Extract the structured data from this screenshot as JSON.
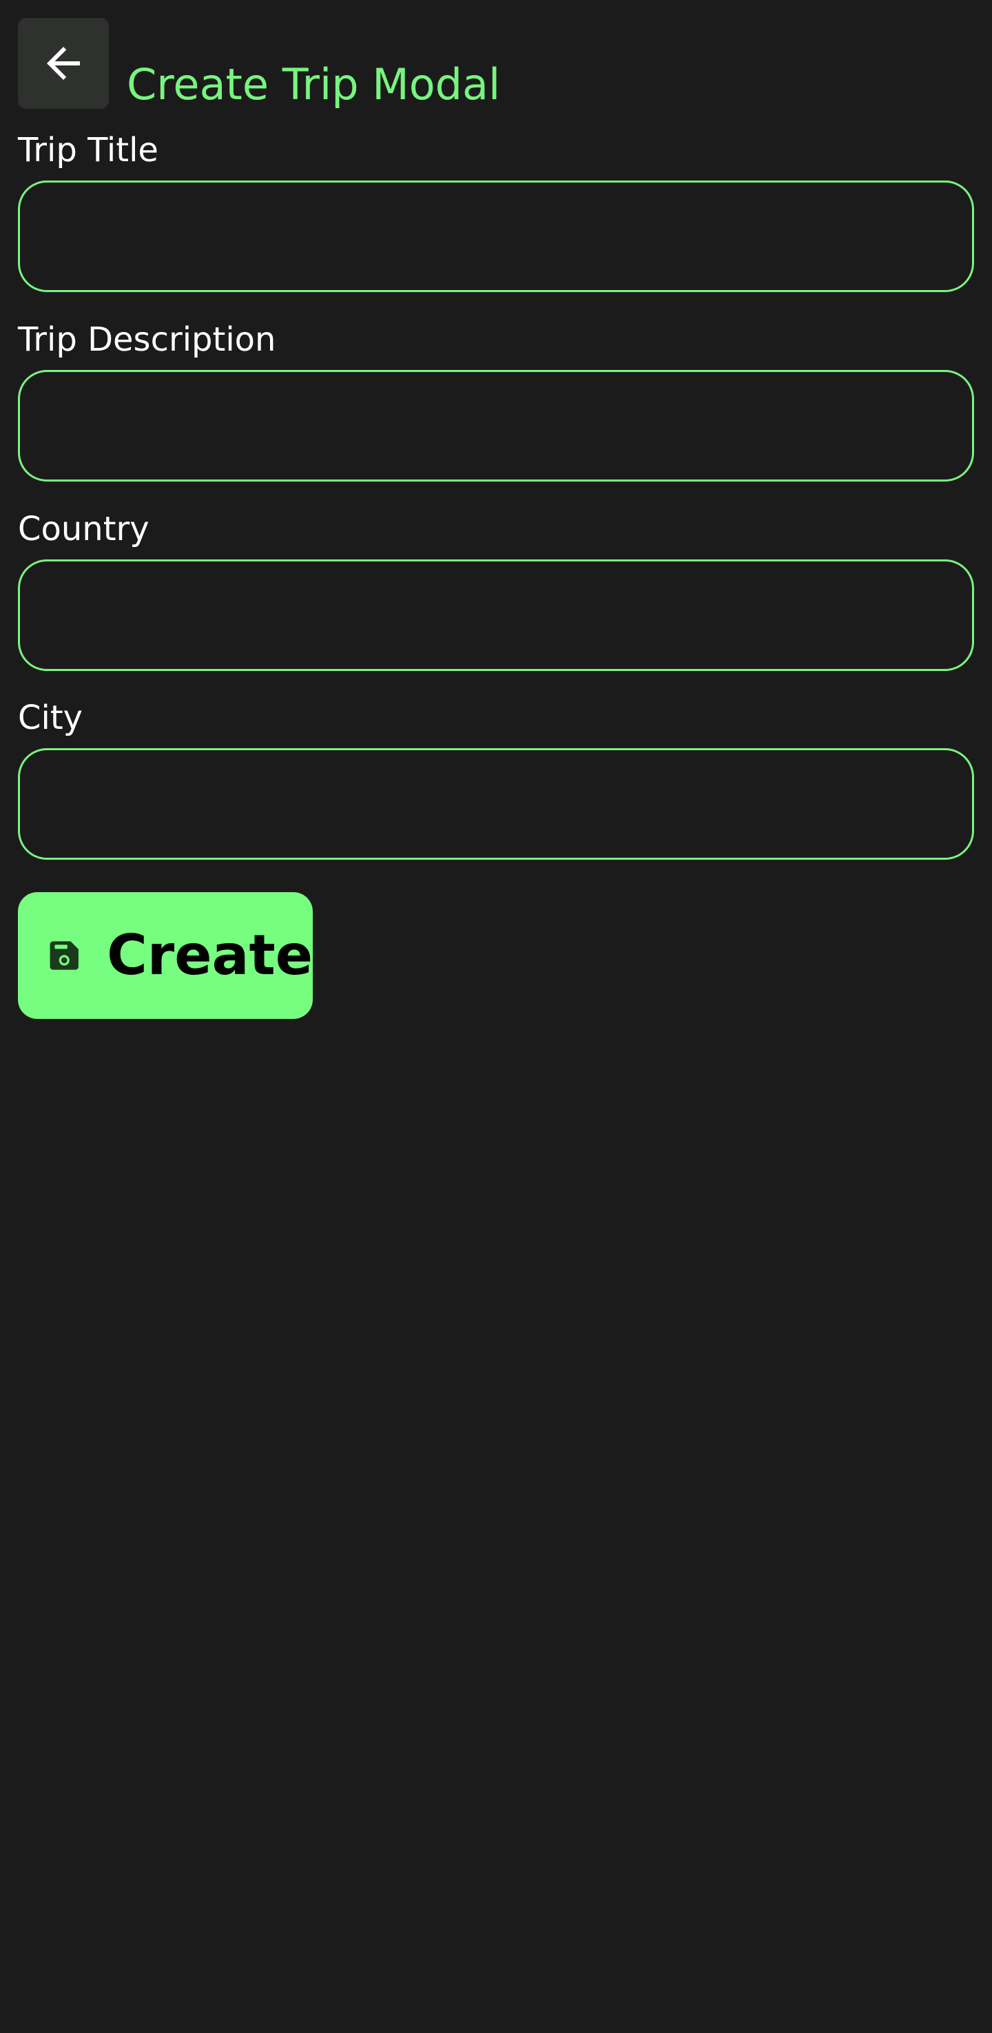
{
  "header": {
    "back_icon": "arrow-left-icon",
    "title": "Create Trip Modal"
  },
  "form": {
    "fields": [
      {
        "label": "Trip Title",
        "value": "",
        "placeholder": ""
      },
      {
        "label": "Trip Description",
        "value": "",
        "placeholder": ""
      },
      {
        "label": "Country",
        "value": "",
        "placeholder": ""
      },
      {
        "label": "City",
        "value": "",
        "placeholder": ""
      }
    ],
    "submit": {
      "icon": "save-icon",
      "label": "Create"
    }
  },
  "colors": {
    "background": "#1c1b1c",
    "accent": "#77f57e",
    "button_bg": "#77fd7f",
    "back_button_bg": "#2e312d",
    "label_text": "#ffffff"
  }
}
